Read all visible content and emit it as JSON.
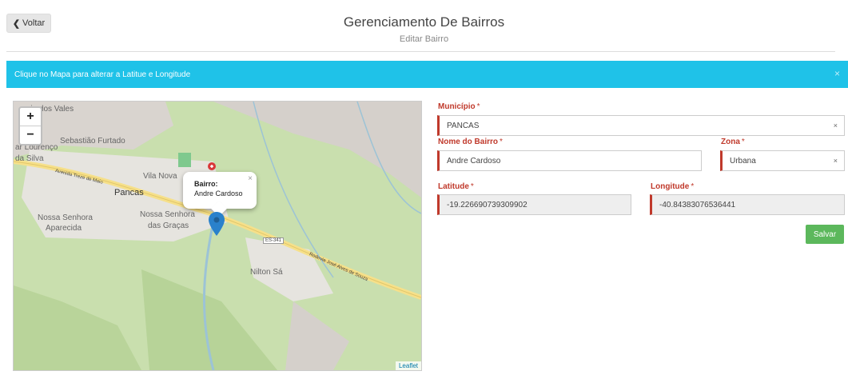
{
  "header": {
    "back_label": "Voltar",
    "title": "Gerenciamento De Bairros",
    "subtitle": "Editar Bairro"
  },
  "alert": {
    "message": "Clique no Mapa para alterar a Latitue e Longitude",
    "close": "×"
  },
  "map": {
    "zoom_in": "+",
    "zoom_out": "−",
    "popup": {
      "label": "Bairro:",
      "value": "Andre Cardoso",
      "close": "×"
    },
    "attribution": "Leaflet",
    "place_labels": [
      "rio dos Vales",
      "Sebastião Furtado",
      "ar Lourenço",
      "da Silva",
      "Vila Nova",
      "Pancas",
      "Nossa Senhora",
      "Aparecida",
      "Nossa Senhora",
      "das Graças",
      "Nilton Sá"
    ],
    "road_labels": [
      "Avenida Treze de Maio",
      "Rodovia José Alves de Souza",
      "ES-341"
    ],
    "marker_icon": "map-marker-icon",
    "poi_icon": "hospital-icon"
  },
  "form": {
    "municipio": {
      "label": "Município",
      "value": "PANCAS",
      "clear": "×"
    },
    "nome_bairro": {
      "label": "Nome do Bairro",
      "value": "Andre Cardoso"
    },
    "zona": {
      "label": "Zona",
      "value": "Urbana",
      "clear": "×"
    },
    "latitude": {
      "label": "Latitude",
      "value": "-19.226690739309902"
    },
    "longitude": {
      "label": "Longitude",
      "value": "-40.84383076536441"
    },
    "required_mark": "*",
    "save_label": "Salvar"
  },
  "colors": {
    "alert_bg": "#1fc2e8",
    "required": "#c0392b",
    "save": "#5cb85c",
    "marker": "#2a81cb"
  }
}
